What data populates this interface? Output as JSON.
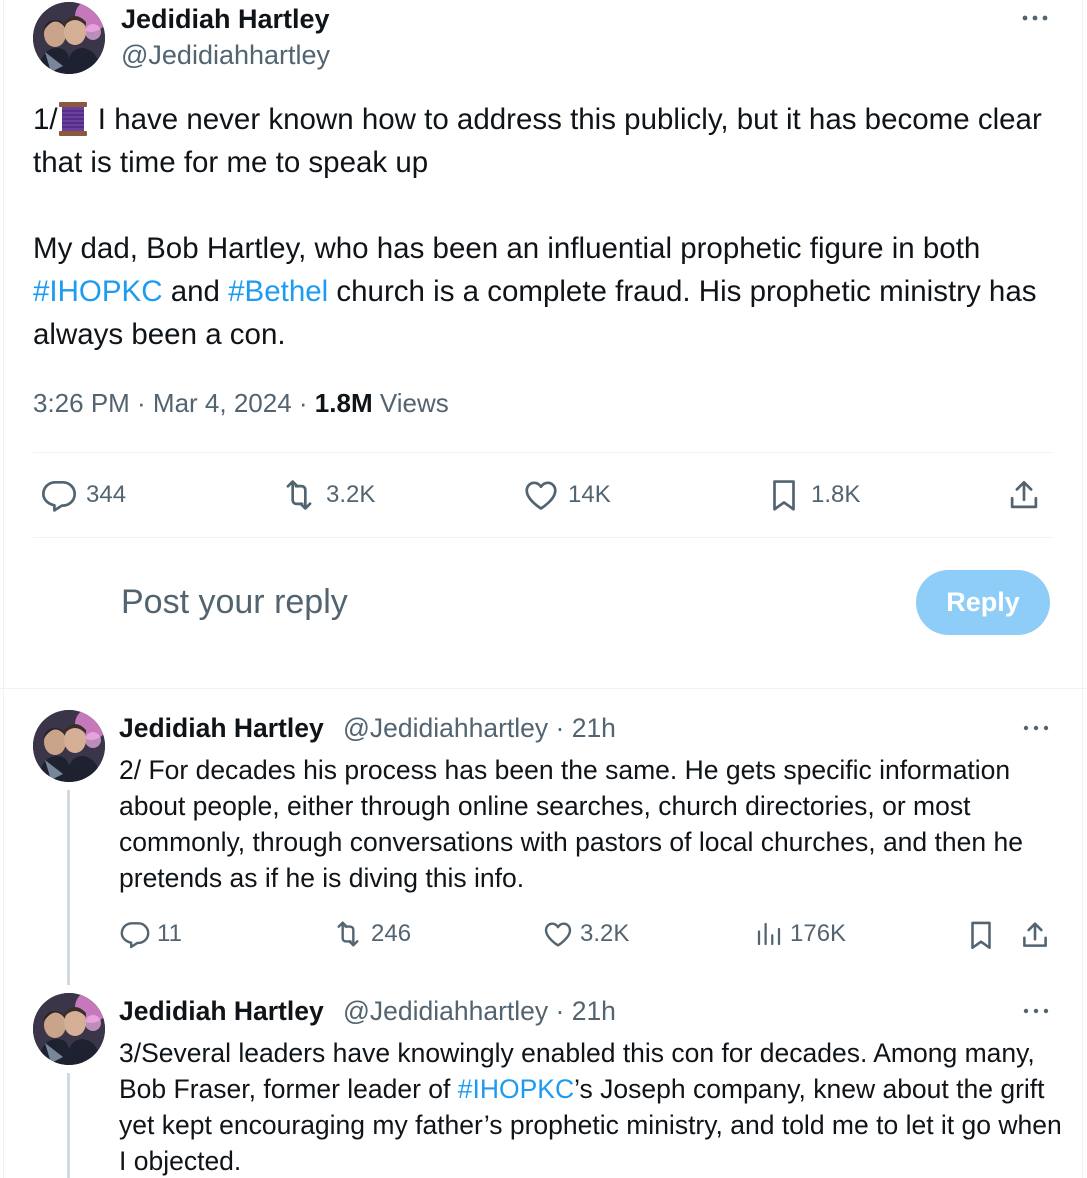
{
  "main_tweet": {
    "author_name": "Jedidiah Hartley",
    "author_handle": "@Jedidiahhartley",
    "text_prefix": "1/",
    "text_line1": " I have never known how to address this publicly, but it has become clear that is time for me to speak up",
    "text_p2_start": "My dad, Bob Hartley, who has been an influential prophetic figure in both ",
    "hashtag1": "#IHOPKC",
    "text_and": " and ",
    "hashtag2": "#Bethel",
    "text_p2_end": " church is a complete fraud. His prophetic ministry has always been a con.",
    "time": "3:26 PM · Mar 4, 2024 · ",
    "views_count": "1.8M",
    "views_label": " Views",
    "stats": {
      "replies": "344",
      "reposts": "3.2K",
      "likes": "14K",
      "bookmarks": "1.8K"
    }
  },
  "reply_composer": {
    "placeholder": "Post your reply",
    "button_label": "Reply"
  },
  "thread": [
    {
      "author_name": "Jedidiah Hartley",
      "author_handle": "@Jedidiahhartley",
      "time_suffix": " · 21h",
      "text": "2/ For decades his process has been the same. He gets specific information about people, either through online searches, church directories, or most commonly, through conversations with pastors of local churches, and then he pretends as if he is diving this info.",
      "stats": {
        "replies": "11",
        "reposts": "246",
        "likes": "3.2K",
        "views": "176K"
      }
    },
    {
      "author_name": "Jedidiah Hartley",
      "author_handle": "@Jedidiahhartley",
      "time_suffix": " · 21h",
      "text_start": "3/Several leaders have knowingly enabled this con for decades. Among many, Bob Fraser, former leader of ",
      "hashtag": "#IHOPKC",
      "text_end": "’s Joseph company, knew about the grift yet kept encouraging my father’s prophetic ministry, and told me to let it go when I objected."
    }
  ],
  "icons": {
    "reply": "speech-bubble-icon",
    "repost": "repost-arrows-icon",
    "like": "heart-icon",
    "bookmark": "bookmark-icon",
    "share": "share-upload-icon",
    "views": "bar-chart-icon",
    "more": "ellipsis-icon",
    "thread_emoji": "spool-of-thread-emoji"
  },
  "colors": {
    "link": "#1d9bf0",
    "secondary_text": "#536471",
    "reply_button_disabled": "#8ecdf7"
  }
}
